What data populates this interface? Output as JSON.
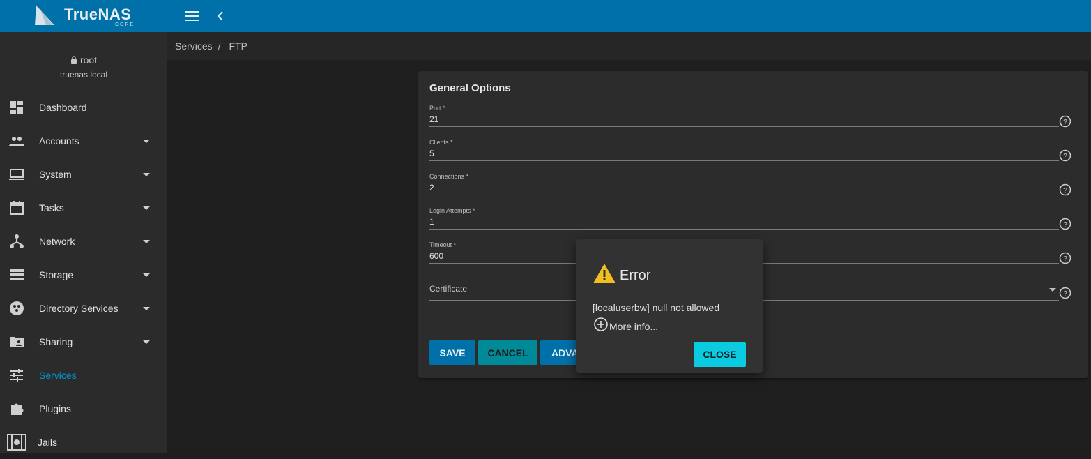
{
  "brand": {
    "name": "TrueNAS",
    "edition": "CORE"
  },
  "user": {
    "name": "root",
    "host": "truenas.local"
  },
  "breadcrumb": [
    "Services",
    "FTP"
  ],
  "sidebar": {
    "items": [
      {
        "label": "Dashboard",
        "icon": "dashboard-icon",
        "expandable": false
      },
      {
        "label": "Accounts",
        "icon": "people-icon",
        "expandable": true
      },
      {
        "label": "System",
        "icon": "laptop-icon",
        "expandable": true
      },
      {
        "label": "Tasks",
        "icon": "calendar-icon",
        "expandable": true
      },
      {
        "label": "Network",
        "icon": "network-icon",
        "expandable": true
      },
      {
        "label": "Storage",
        "icon": "storage-icon",
        "expandable": true
      },
      {
        "label": "Directory Services",
        "icon": "directory-icon",
        "expandable": true
      },
      {
        "label": "Sharing",
        "icon": "folder-shared-icon",
        "expandable": true
      },
      {
        "label": "Services",
        "icon": "tune-icon",
        "expandable": false,
        "active": true
      },
      {
        "label": "Plugins",
        "icon": "puzzle-icon",
        "expandable": false
      },
      {
        "label": "Jails",
        "icon": "jail-icon",
        "expandable": false
      }
    ]
  },
  "form": {
    "title": "General Options",
    "fields": [
      {
        "label": "Port *",
        "value": "21"
      },
      {
        "label": "Clients *",
        "value": "5"
      },
      {
        "label": "Connections *",
        "value": "2"
      },
      {
        "label": "Login Attempts *",
        "value": "1"
      },
      {
        "label": "Timeout *",
        "value": "600"
      }
    ],
    "certificate": {
      "label": "Certificate"
    },
    "buttons": {
      "save": "SAVE",
      "cancel": "CANCEL",
      "advanced": "ADVA"
    }
  },
  "dialog": {
    "title": "Error",
    "message": "[localuserbw] null not allowed",
    "more_info": "More info...",
    "close": "CLOSE"
  },
  "colors": {
    "topbar": "#0071a8",
    "active_nav": "#0095d5",
    "close_button": "#0acbe0",
    "warning": "#f2c01e"
  }
}
